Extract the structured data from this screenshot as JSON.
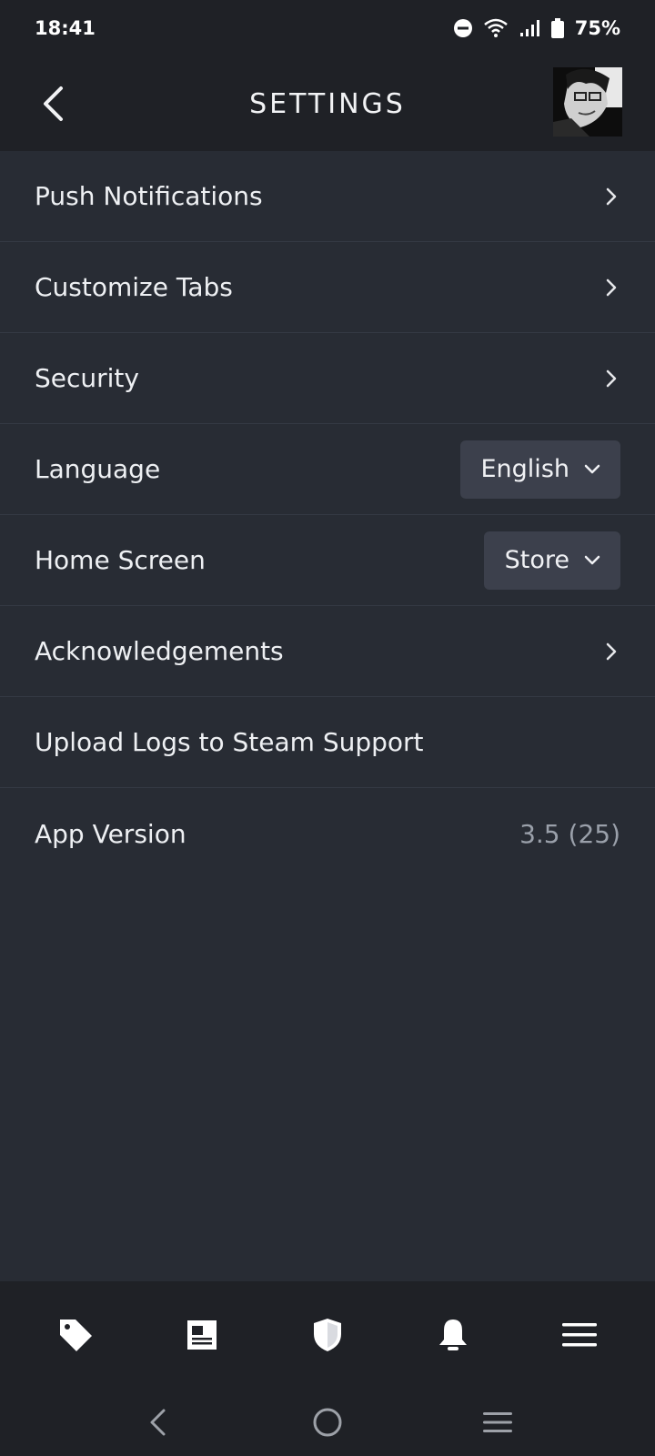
{
  "status": {
    "time": "18:41",
    "battery": "75%",
    "icons": [
      "dnd-icon",
      "wifi-icon",
      "signal-icon",
      "battery-icon"
    ]
  },
  "header": {
    "title": "SETTINGS"
  },
  "settings": {
    "rows": [
      {
        "label": "Push Notifications",
        "kind": "link"
      },
      {
        "label": "Customize Tabs",
        "kind": "link"
      },
      {
        "label": "Security",
        "kind": "link"
      },
      {
        "label": "Language",
        "kind": "dropdown",
        "value": "English"
      },
      {
        "label": "Home Screen",
        "kind": "dropdown",
        "value": "Store"
      },
      {
        "label": "Acknowledgements",
        "kind": "link"
      },
      {
        "label": "Upload Logs to Steam Support",
        "kind": "action"
      },
      {
        "label": "App Version",
        "kind": "info",
        "value": "3.5 (25)"
      }
    ]
  },
  "bottom_nav": {
    "items": [
      "tag-icon",
      "news-icon",
      "shield-icon",
      "bell-icon",
      "menu-icon"
    ]
  },
  "system_nav": {
    "items": [
      "back-icon",
      "home-icon",
      "recents-icon"
    ]
  },
  "colors": {
    "background": "#282c34",
    "bar": "#1f2126",
    "divider": "#353a44",
    "dropdown": "#3c404c",
    "muted_text": "#9aa0aa"
  }
}
